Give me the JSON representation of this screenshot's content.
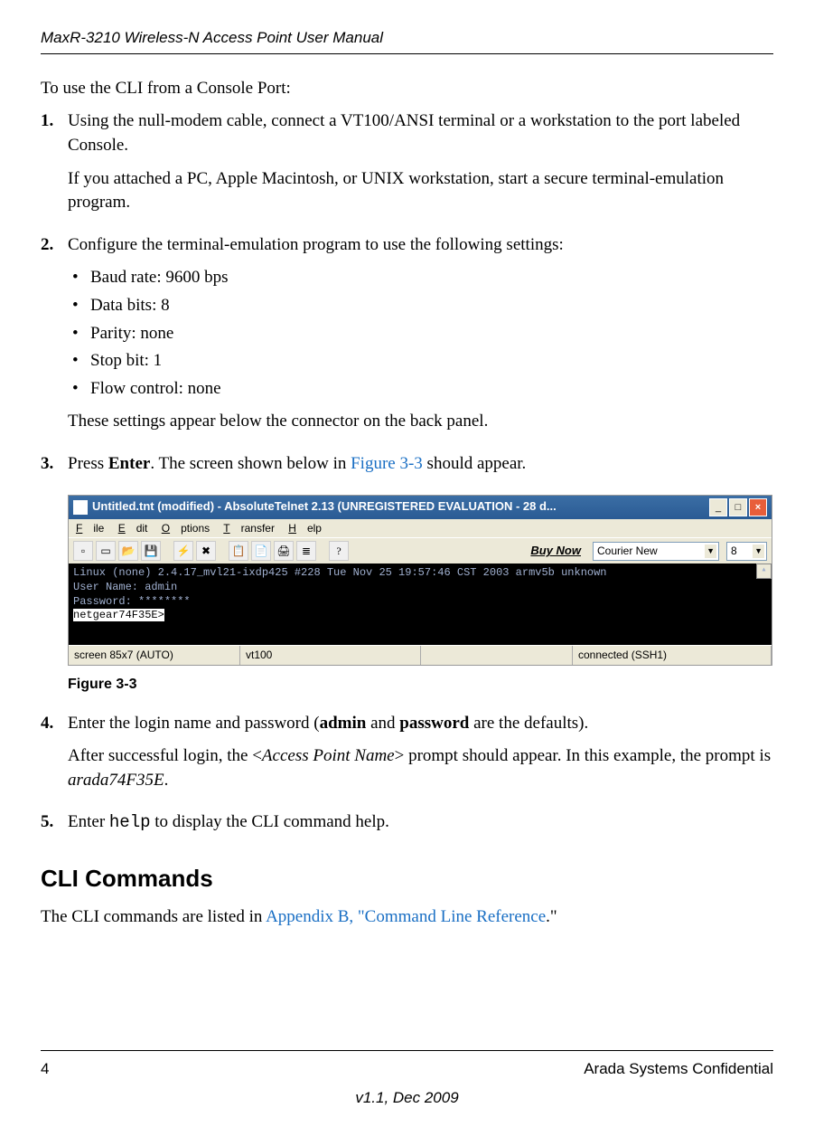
{
  "header": "MaxR-3210 Wireless-N Access Point User Manual",
  "intro": "To use the CLI from a Console Port:",
  "steps": {
    "s1": {
      "num": "1.",
      "p1": "Using the null-modem cable, connect a VT100/ANSI terminal or a workstation to the port labeled Console.",
      "p2": "If you attached a PC, Apple Macintosh, or UNIX workstation, start a secure terminal-emulation program."
    },
    "s2": {
      "num": "2.",
      "p1": "Configure the terminal-emulation program to use the following settings:",
      "bullets": {
        "b0": "Baud rate: 9600 bps",
        "b1": "Data bits: 8",
        "b2": "Parity: none",
        "b3": "Stop bit: 1",
        "b4": "Flow control: none"
      },
      "p2": "These settings appear below the connector on the back panel."
    },
    "s3": {
      "num": "3.",
      "pre": "Press ",
      "enter": "Enter",
      "mid": ". The screen shown below in ",
      "figref": "Figure 3-3",
      "post": " should appear."
    },
    "s4": {
      "num": "4.",
      "p1a": "Enter the login name and password (",
      "admin": "admin",
      "and": " and ",
      "password": "password",
      "p1b": " are the defaults).",
      "p2a": "After successful login, the <",
      "apn": "Access Point Name",
      "p2b": "> prompt should appear. In this example, the prompt is ",
      "prompt": "arada74F35E",
      "p2c": "."
    },
    "s5": {
      "num": "5.",
      "pre": "Enter ",
      "help": "help",
      "post": " to display the CLI command help."
    }
  },
  "figure": {
    "title": "Untitled.tnt (modified) - AbsoluteTelnet 2.13   (UNREGISTERED EVALUATION - 28 d...",
    "menu": {
      "file": "File",
      "edit": "Edit",
      "options": "Options",
      "transfer": "Transfer",
      "help": "Help"
    },
    "toolbar": {
      "buynow": "Buy Now",
      "font": "Courier New",
      "size": "8"
    },
    "terminal": {
      "l1": "Linux (none) 2.4.17_mvl21-ixdp425 #228 Tue Nov 25 19:57:46 CST 2003 armv5b unknown",
      "l2": "User Name: admin",
      "l3": "Password: ********",
      "l4": "netgear74F35E>"
    },
    "status": {
      "s1": "screen 85x7 (AUTO)",
      "s2": "vt100",
      "s3": "connected (SSH1)"
    },
    "caption": "Figure 3-3"
  },
  "h2": "CLI Commands",
  "cli_text": {
    "pre": "The CLI commands are listed in ",
    "link": "Appendix B, \"Command Line Reference",
    "post": ".\""
  },
  "footer": {
    "page": "4",
    "conf": "Arada Systems Confidential",
    "version": "v1.1, Dec 2009"
  }
}
